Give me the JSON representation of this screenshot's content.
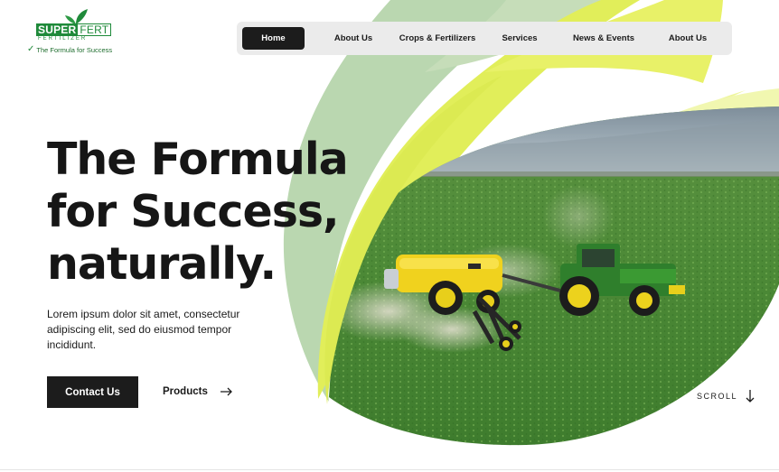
{
  "brand": {
    "word_left": "SUPER",
    "word_right": "FERT",
    "subtitle": "FERTILIZER",
    "tagline": "The Formula for Success",
    "green": "#1f8a3a"
  },
  "nav": {
    "items": [
      {
        "label": "Home",
        "active": true
      },
      {
        "label": "About Us",
        "active": false
      },
      {
        "label": "Crops & Fertilizers",
        "active": false
      },
      {
        "label": "Services",
        "active": false
      },
      {
        "label": "News & Events",
        "active": false
      },
      {
        "label": "About Us",
        "active": false
      }
    ]
  },
  "hero": {
    "headline": [
      "The Formula",
      "for Success,",
      "naturally."
    ],
    "lead": "Lorem ipsum dolor sit amet, consectetur adipiscing elit, sed do eiusmod tempor incididunt.",
    "primary_cta": "Contact Us",
    "secondary_cta": "Products",
    "scroll_label": "SCROLL",
    "image_alt": "Tractor spreading fertilizer on a green crop field",
    "icons": [
      "arrow-right-icon",
      "arrow-down-icon"
    ]
  },
  "colors": {
    "ink": "#161616",
    "leaf_lime": "#e1ee5a",
    "leaf_sage": "#bad7b0",
    "leaf_pale": "#eef69a",
    "field_green": "#4a8a36"
  }
}
